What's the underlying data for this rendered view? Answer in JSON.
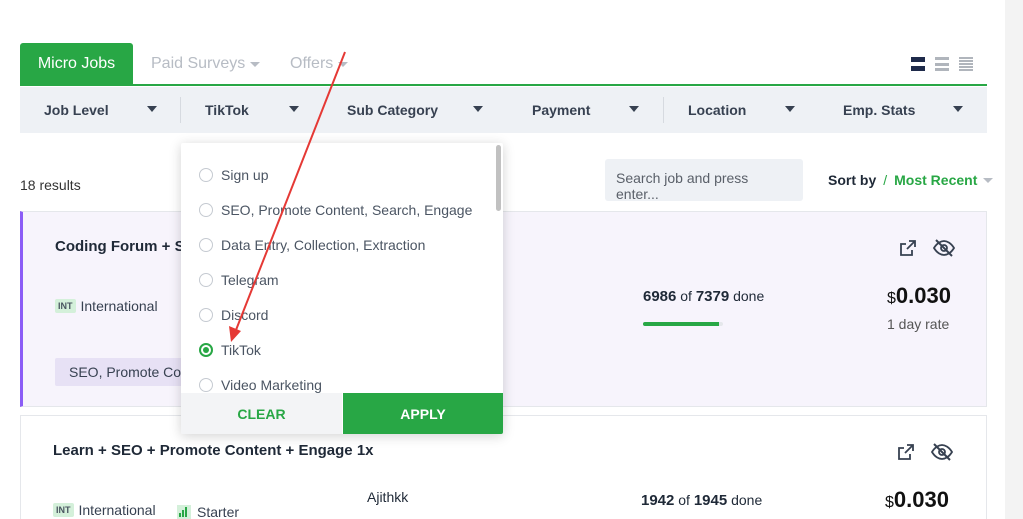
{
  "tabs": [
    {
      "label": "Micro Jobs"
    },
    {
      "label": "Paid Surveys"
    },
    {
      "label": "Offers"
    }
  ],
  "filters": [
    {
      "label": "Job Level"
    },
    {
      "label": "TikTok"
    },
    {
      "label": "Sub Category"
    },
    {
      "label": "Payment"
    },
    {
      "label": "Location"
    },
    {
      "label": "Emp. Stats"
    }
  ],
  "results_text": "18 results",
  "search": {
    "placeholder": "Search job and press enter..."
  },
  "sort": {
    "label": "Sort by",
    "separator": "/",
    "value": "Most Recent"
  },
  "subcategory_dropdown": {
    "options": [
      {
        "label": "Sign up",
        "selected": false
      },
      {
        "label": "SEO, Promote Content, Search, Engage",
        "selected": false
      },
      {
        "label": "Data Entry, Collection, Extraction",
        "selected": false
      },
      {
        "label": "Telegram",
        "selected": false
      },
      {
        "label": "Discord",
        "selected": false
      },
      {
        "label": "TikTok",
        "selected": true
      },
      {
        "label": "Video Marketing",
        "selected": false
      }
    ],
    "clear_label": "CLEAR",
    "apply_label": "APPLY"
  },
  "jobs": [
    {
      "title": "Coding Forum + SE",
      "location_badge": "INT",
      "location": "International",
      "tag": "SEO, Promote Con",
      "done": "6986",
      "total": "7379",
      "of_text": "of",
      "done_text": "done",
      "progress": 0.947,
      "currency": "$",
      "price": "0.030",
      "rate": "1 day rate"
    },
    {
      "title": "Learn + SEO + Promote Content + Engage 1x",
      "location_badge": "INT",
      "location": "International",
      "level": "Starter",
      "user": "Ajithkk",
      "done": "1942",
      "total": "1945",
      "of_text": "of",
      "done_text": "done",
      "currency": "$",
      "price": "0.030"
    }
  ],
  "colors": {
    "accent": "#28a745",
    "card_highlight_border": "#8b5cf6",
    "annotation_arrow": "#e53935"
  },
  "icons": [
    "list-view-icon",
    "compact-view-icon",
    "dense-view-icon",
    "external-link-icon",
    "hide-eye-icon",
    "level-bars-icon"
  ]
}
